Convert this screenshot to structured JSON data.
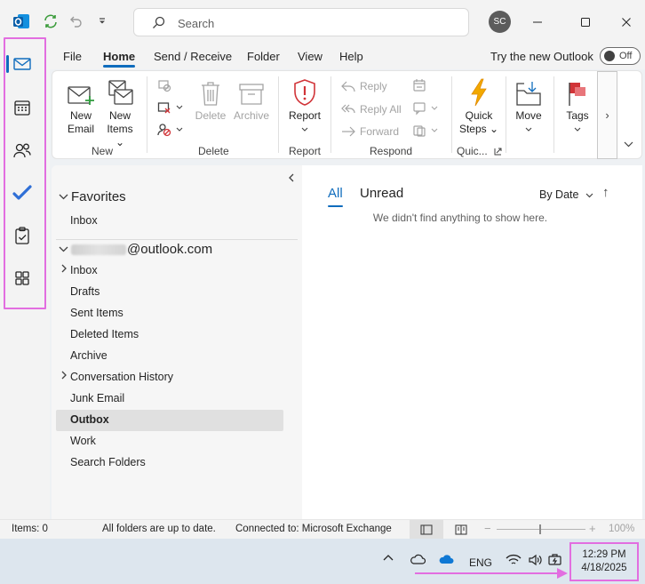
{
  "titlebar": {
    "search_placeholder": "Search",
    "avatar_initials": "SC"
  },
  "menu": {
    "tabs": [
      "File",
      "Home",
      "Send / Receive",
      "Folder",
      "View",
      "Help"
    ],
    "active_tab": "Home",
    "try_new_label": "Try the new Outlook",
    "toggle_state": "Off"
  },
  "ribbon": {
    "new_email": [
      "New",
      "Email"
    ],
    "new_items": [
      "New",
      "Items ⌄"
    ],
    "delete_label": "Delete",
    "archive_label": "Archive",
    "report_label": "Report",
    "reply_label": "Reply",
    "reply_all_label": "Reply All",
    "forward_label": "Forward",
    "quick_steps": [
      "Quick",
      "Steps ⌄"
    ],
    "move_label": "Move",
    "tags_label": "Tags",
    "groups": {
      "new": "New",
      "delete": "Delete",
      "report": "Report",
      "respond": "Respond",
      "quick": "Quic..."
    },
    "more_label": "›",
    "collapse_label": "⌄"
  },
  "folders": {
    "favorites_label": "Favorites",
    "favorites": [
      "Inbox"
    ],
    "account_suffix": "@outlook.com",
    "items": [
      {
        "label": "Inbox",
        "expandable": true
      },
      {
        "label": "Drafts",
        "expandable": false
      },
      {
        "label": "Sent Items",
        "expandable": false
      },
      {
        "label": "Deleted Items",
        "expandable": false
      },
      {
        "label": "Archive",
        "expandable": false
      },
      {
        "label": "Conversation History",
        "expandable": true
      },
      {
        "label": "Junk Email",
        "expandable": false
      },
      {
        "label": "Outbox",
        "expandable": false,
        "selected": true
      },
      {
        "label": "Work",
        "expandable": false
      },
      {
        "label": "Search Folders",
        "expandable": false
      }
    ]
  },
  "messages": {
    "tab_all": "All",
    "tab_unread": "Unread",
    "sort_label": "By Date",
    "sort_dir": "↑",
    "empty_text": "We didn't find anything to show here."
  },
  "status": {
    "items": "Items: 0",
    "sync": "All folders are up to date.",
    "connection": "Connected to: Microsoft Exchange",
    "zoom_minus": "−",
    "zoom_plus": "+",
    "zoom": "100%"
  },
  "taskbar": {
    "lang": "ENG",
    "time": "12:29 PM",
    "date": "4/18/2025"
  },
  "colors": {
    "accent": "#0f6cbd",
    "highlight": "#e26ee0"
  }
}
